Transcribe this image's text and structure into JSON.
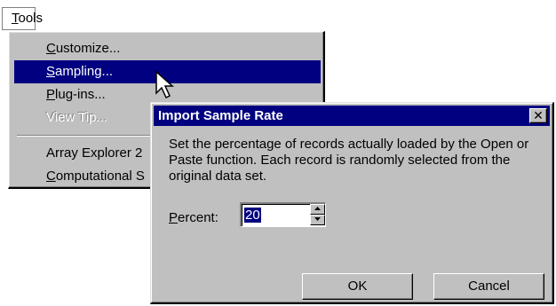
{
  "menubar": {
    "label": "Tools"
  },
  "menu": {
    "items": [
      {
        "label": "Customize...",
        "state": "normal"
      },
      {
        "label": "Sampling...",
        "state": "active"
      },
      {
        "label": "Plug-ins...",
        "state": "normal"
      },
      {
        "label": "View Tip...",
        "state": "disabled"
      },
      {
        "label": "Array Explorer 2",
        "state": "normal"
      },
      {
        "label": "Computational S",
        "state": "normal"
      }
    ]
  },
  "dialog": {
    "title": "Import Sample Rate",
    "close_glyph": "✕",
    "description": "Set the percentage of records actually loaded by the Open or Paste function. Each record is randomly selected from the original data set.",
    "percent_label": "Percent:",
    "percent_value": "20",
    "ok_label": "OK",
    "cancel_label": "Cancel"
  },
  "icons": {
    "cursor": "arrow-cursor-icon",
    "spin_up": "triangle-up-icon",
    "spin_down": "triangle-down-icon"
  },
  "colors": {
    "highlight": "#000080",
    "face": "#c0c0c0"
  }
}
